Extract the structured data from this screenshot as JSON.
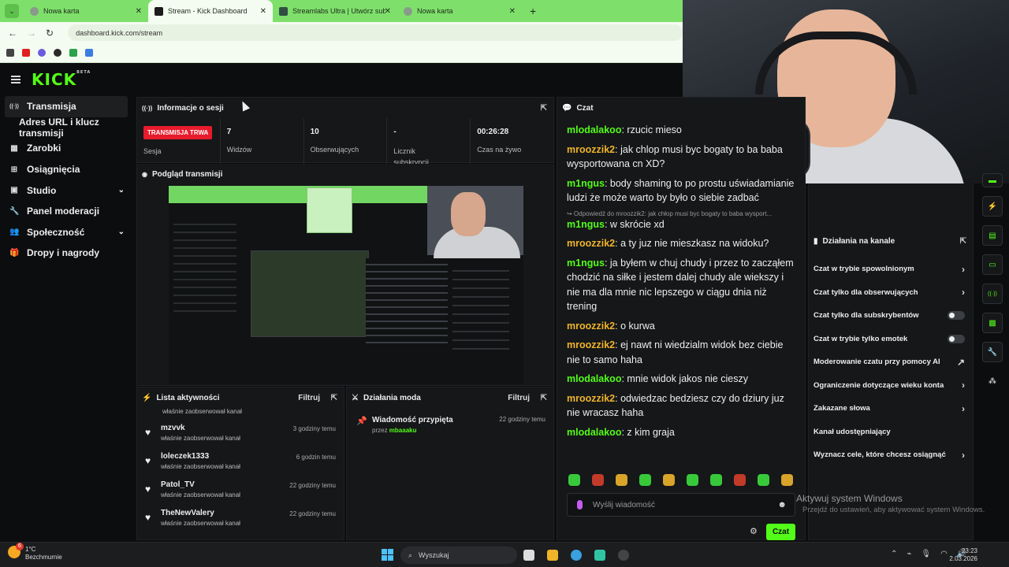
{
  "browser": {
    "tabs": [
      {
        "label": "Nowa karta",
        "active": false
      },
      {
        "label": "Stream - Kick Dashboard",
        "active": true
      },
      {
        "label": "Streamlabs Ultra | Utwórz subsk",
        "active": false
      },
      {
        "label": "Nowa karta",
        "active": false
      }
    ],
    "url": "dashboard.kick.com/stream",
    "tab_close": "✕",
    "new_tab": "+"
  },
  "logo": {
    "text": "KICK",
    "badge": "BETA"
  },
  "sidebar": {
    "items": [
      {
        "label": "Transmisja",
        "icon": "broadcast-icon",
        "glyph": "((·))",
        "active": true
      },
      {
        "label": "Adres URL i klucz transmisji",
        "icon": "",
        "glyph": "",
        "sub": true
      },
      {
        "label": "Zarobki",
        "icon": "earnings-icon",
        "glyph": "▦"
      },
      {
        "label": "Osiągnięcia",
        "icon": "achievements-icon",
        "glyph": "⊞"
      },
      {
        "label": "Studio",
        "icon": "studio-icon",
        "glyph": "▣",
        "chevron": "⌄"
      },
      {
        "label": "Panel moderacji",
        "icon": "wrench-icon",
        "glyph": "🔧"
      },
      {
        "label": "Społeczność",
        "icon": "community-icon",
        "glyph": "👥",
        "chevron": "⌄"
      },
      {
        "label": "Dropy i nagrody",
        "icon": "gift-icon",
        "glyph": "🎁"
      }
    ]
  },
  "session": {
    "title": "Informacje o sesji",
    "stats": [
      {
        "value": "TRANSMISJA TRWA",
        "label": "Sesja",
        "badge": true
      },
      {
        "value": "7",
        "label": "Widzów"
      },
      {
        "value": "10",
        "label": "Obserwujących"
      },
      {
        "value": "-",
        "label": "Licznik subskrypcji"
      },
      {
        "value": "00:26:28",
        "label": "Czas na żywo"
      }
    ]
  },
  "preview": {
    "title": "Podgląd transmisji"
  },
  "activity": {
    "title": "Lista aktywności",
    "filter": "Filtruj",
    "top_text": "właśnie zaobserwował kanał",
    "rows": [
      {
        "name": "mzvvk",
        "desc": "właśnie zaobserwował kanał",
        "time": "3 godziny temu"
      },
      {
        "name": "loleczek1333",
        "desc": "właśnie zaobserwował kanał",
        "time": "6 godzin temu"
      },
      {
        "name": "Patol_TV",
        "desc": "właśnie zaobserwował kanał",
        "time": "22 godziny temu"
      },
      {
        "name": "TheNewValery",
        "desc": "właśnie zaobserwował kanał",
        "time": "22 godziny temu"
      }
    ]
  },
  "mod_actions": {
    "title": "Działania moda",
    "filter": "Filtruj",
    "item": {
      "title": "Wiadomość przypięta",
      "by_prefix": "przez",
      "by_user": "mbaaaku",
      "time": "22 godziny temu"
    }
  },
  "chat": {
    "title": "Czat",
    "messages": [
      {
        "user": "mlodalakoo",
        "color": "#53fc18",
        "text": "rzucic mieso"
      },
      {
        "user": "mroozzik2",
        "color": "#f0b429",
        "text": "jak chlop musi byc bogaty to ba baba wysportowana cn XD?"
      },
      {
        "user": "m1ngus",
        "color": "#53fc18",
        "text": "body shaming to po prostu uświadamianie ludzi że może warto by było o siebie zadbać"
      },
      {
        "user": "m1ngus",
        "color": "#53fc18",
        "text": "w skrócie xd",
        "reply": "↪ Odpowiedź do mroozzik2: jak chłop musi byc bogaty to baba wysport..."
      },
      {
        "user": "mroozzik2",
        "color": "#f0b429",
        "text": "a ty juz nie mieszkasz na widoku?"
      },
      {
        "user": "m1ngus",
        "color": "#53fc18",
        "text": "ja byłem w chuj chudy i przez to zacząłem chodzić na siłke i jestem dalej chudy ale wiekszy i nie ma dla mnie nic lepszego w ciągu dnia niż trening"
      },
      {
        "user": "mroozzik2",
        "color": "#f0b429",
        "text": "o kurwa"
      },
      {
        "user": "mroozzik2",
        "color": "#f0b429",
        "text": "ej nawt ni wiedzialm widok bez ciebie nie to samo haha"
      },
      {
        "user": "mlodalakoo",
        "color": "#53fc18",
        "text": "mnie widok jakos nie cieszy"
      },
      {
        "user": "mroozzik2",
        "color": "#f0b429",
        "text": "odwiedzac bedziesz czy do dziury juz nie wracasz haha"
      },
      {
        "user": "mlodalakoo",
        "color": "#53fc18",
        "text": "z kim graja"
      }
    ],
    "input_placeholder": "Wyślij wiadomość",
    "send": "Czat"
  },
  "channel_actions": {
    "title": "Działania na kanale",
    "items": [
      {
        "label": "Czat w trybie spowolnionym",
        "control": "›"
      },
      {
        "label": "Czat tylko dla obserwujących",
        "control": "›"
      },
      {
        "label": "Czat tylko dla subskrybentów",
        "control": "toggle"
      },
      {
        "label": "Czat w trybie tylko emotek",
        "control": "toggle"
      },
      {
        "label": "Moderowanie czatu przy pomocy AI",
        "control": "↗"
      },
      {
        "label": "Ograniczenie dotyczące wieku konta",
        "control": "›"
      },
      {
        "label": "Zakazane słowa",
        "control": "›"
      },
      {
        "label": "Kanał udostępniający",
        "control": ""
      },
      {
        "label": "Wyznacz cele, które chcesz osiągnąć",
        "control": "›"
      }
    ]
  },
  "watermark": {
    "line1": "Aktywuj system Windows",
    "line2": "Przejdź do ustawień, aby aktywować system Windows."
  },
  "taskbar": {
    "temp": "1°C",
    "weather": "Bezchmurnie",
    "weather_badge": "6",
    "search": "Wyszukaj",
    "time": "23:23",
    "date": "2.03.2026"
  },
  "colors": {
    "accent": "#53fc18",
    "live": "#e81b2c",
    "yellow_user": "#f0b429"
  }
}
